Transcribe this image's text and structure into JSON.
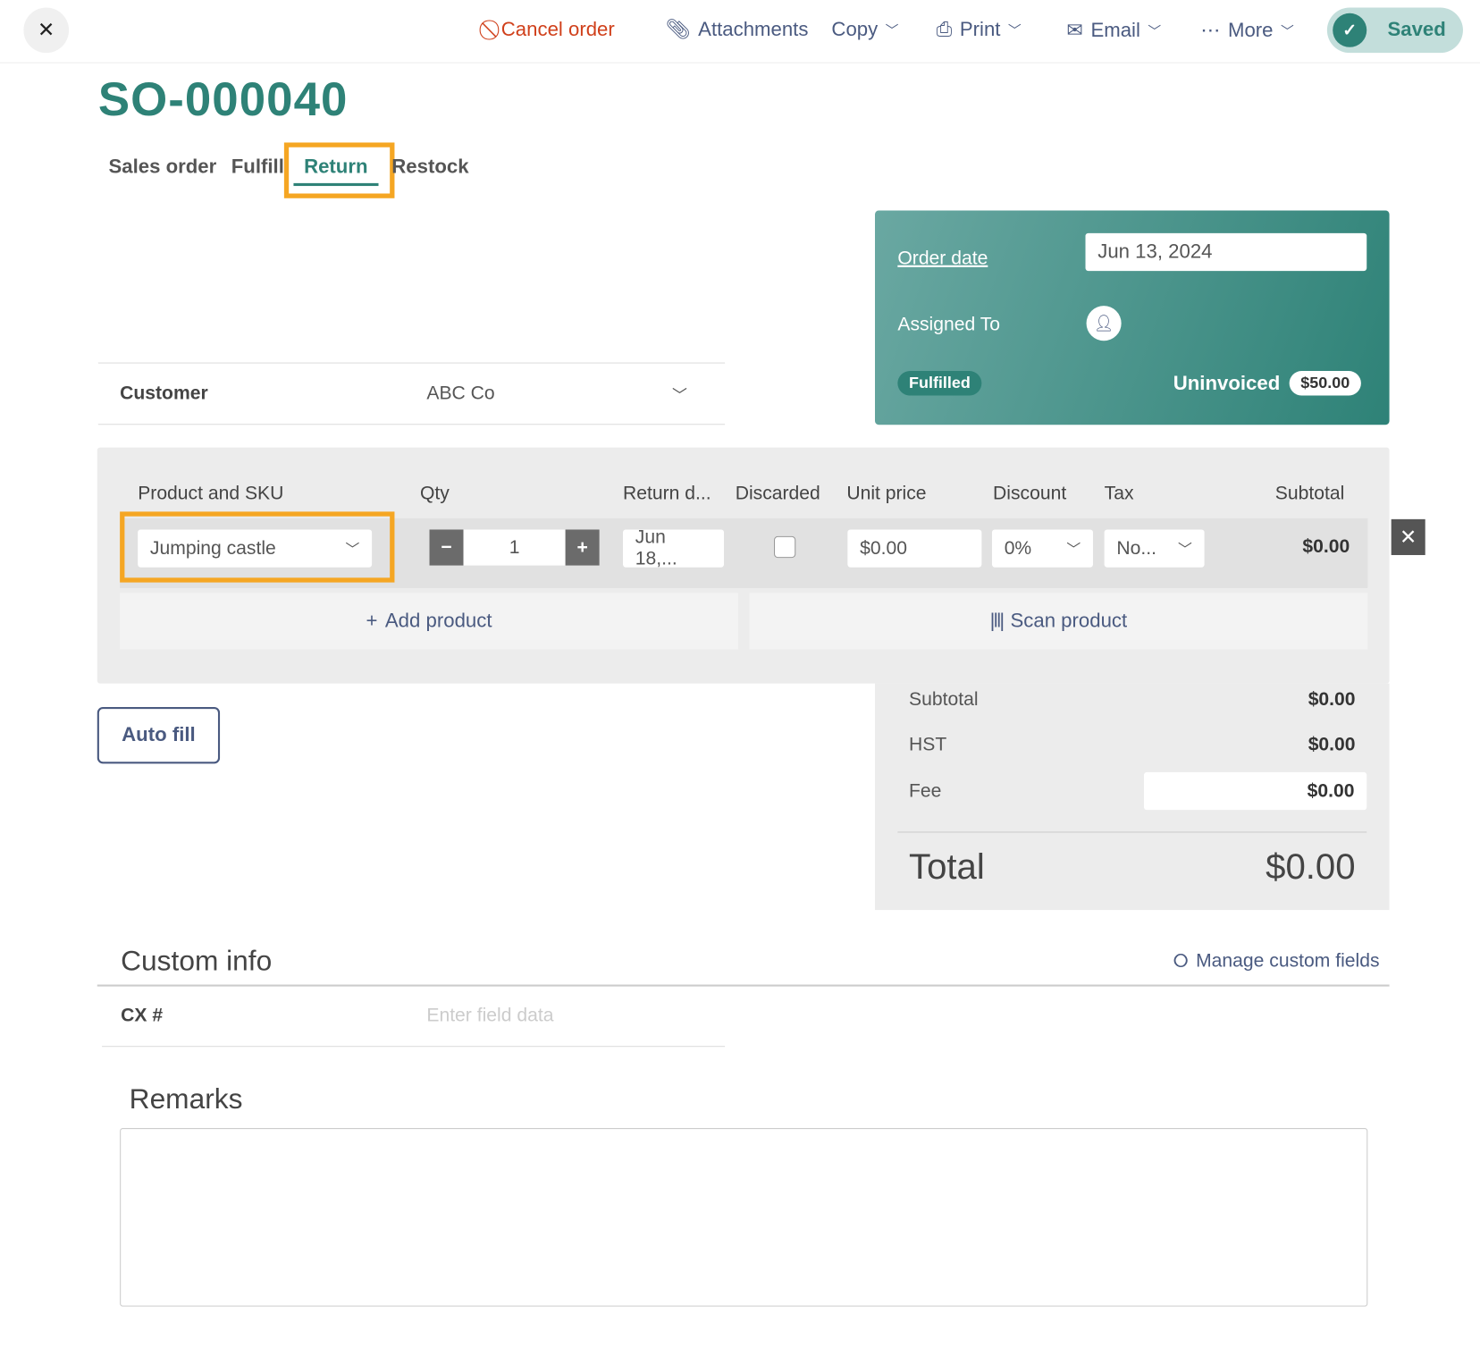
{
  "toolbar": {
    "cancel": "Cancel order",
    "attachments": "Attachments",
    "copy": "Copy",
    "print": "Print",
    "email": "Email",
    "more": "More",
    "saved": "Saved"
  },
  "title": "SO-000040",
  "tabs": [
    {
      "label": "Sales order"
    },
    {
      "label": "Fulfill"
    },
    {
      "label": "Return",
      "active": true
    },
    {
      "label": "Restock"
    }
  ],
  "panel": {
    "order_date_label": "Order date",
    "order_date": "Jun 13, 2024",
    "assigned_label": "Assigned To",
    "status": "Fulfilled",
    "invoice_status": "Uninvoiced",
    "invoice_amount": "$50.00"
  },
  "customer": {
    "label": "Customer",
    "value": "ABC Co"
  },
  "table": {
    "headers": [
      "Product and SKU",
      "Qty",
      "Return d...",
      "Discarded",
      "Unit price",
      "Discount",
      "Tax",
      "Subtotal"
    ],
    "row": {
      "product": "Jumping castle",
      "qty": "1",
      "return_date": "Jun 18,...",
      "discarded": false,
      "unit_price": "$0.00",
      "discount": "0%",
      "tax": "No...",
      "subtotal": "$0.00"
    },
    "add_product": "Add product",
    "scan_product": "Scan product"
  },
  "auto_fill": "Auto fill",
  "totals": {
    "subtotal_label": "Subtotal",
    "subtotal": "$0.00",
    "hst_label": "HST",
    "hst": "$0.00",
    "fee_label": "Fee",
    "fee": "$0.00",
    "total_label": "Total",
    "total": "$0.00"
  },
  "custom_info": {
    "title": "Custom info",
    "manage": "Manage custom fields",
    "field_label": "CX #",
    "field_placeholder": "Enter field data"
  },
  "remarks": {
    "title": "Remarks",
    "value": ""
  },
  "colors": {
    "accent": "#2e8277",
    "highlight": "#f5a623",
    "danger": "#d0401b",
    "link": "#4a5a80"
  }
}
